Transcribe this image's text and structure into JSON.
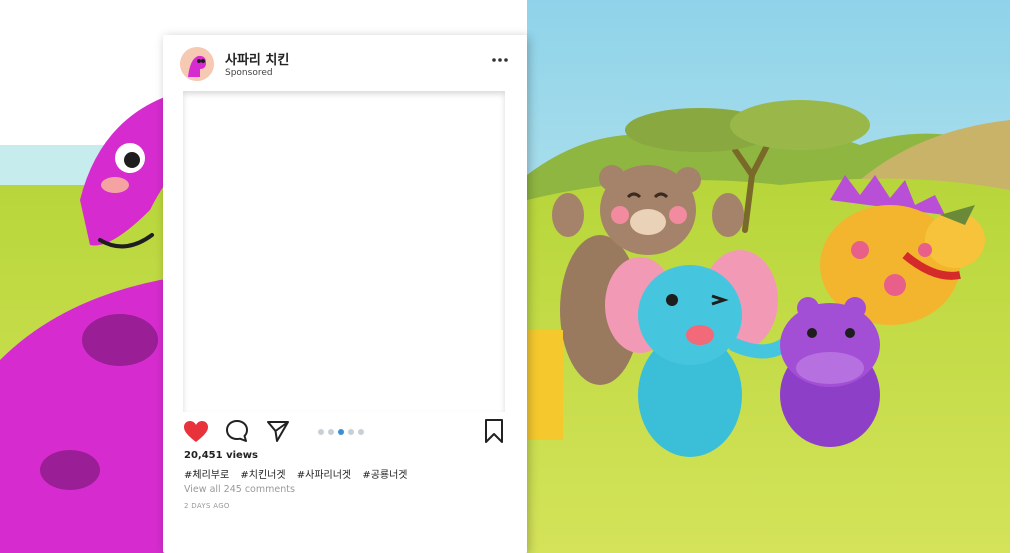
{
  "post": {
    "account_name": "사파리 치킨",
    "sponsored_label": "Sponsored",
    "views": "20,451 views",
    "hashtags": [
      "#체리부로",
      "#치킨너겟",
      "#사파리너겟",
      "#공룡너겟"
    ],
    "view_comments": "View all 245 comments",
    "date": "2 DAYS AGO",
    "carousel": {
      "count": 5,
      "active_index": 2
    },
    "liked": true
  },
  "colors": {
    "like_heart": "#e8323c",
    "carousel_active": "#3a8fd8",
    "dinosaur": "#d62ccf",
    "sky": "#a9e2ef",
    "grass": "#bcd83a"
  },
  "icons": {
    "more": "more-dots-icon",
    "like": "heart-icon",
    "comment": "comment-bubble-icon",
    "share": "paper-plane-icon",
    "save": "bookmark-icon"
  }
}
